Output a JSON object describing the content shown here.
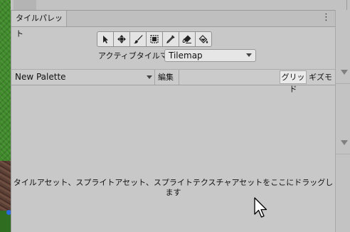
{
  "window": {
    "tab_title": "タイルパレット"
  },
  "toolbar": {
    "tools": [
      {
        "name": "select-tool",
        "icon": "arrow-cursor-icon"
      },
      {
        "name": "move-tool",
        "icon": "move-arrows-icon"
      },
      {
        "name": "paint-tool",
        "icon": "paintbrush-icon"
      },
      {
        "name": "box-fill-tool",
        "icon": "box-fill-icon"
      },
      {
        "name": "picker-tool",
        "icon": "eyedropper-icon"
      },
      {
        "name": "erase-tool",
        "icon": "eraser-icon"
      },
      {
        "name": "fill-tool",
        "icon": "paint-bucket-icon"
      }
    ]
  },
  "active_tilemap": {
    "label": "アクティブタイルマッ",
    "value": "Tilemap"
  },
  "palette_bar": {
    "palette_name": "New Palette",
    "edit_label": "編集",
    "grid_label": "グリッド",
    "gizmo_label": "ギズモ"
  },
  "canvas": {
    "drop_message": "タイルアセット、スプライトアセット、スプライトテクスチャアセットをここにドラッグします"
  }
}
